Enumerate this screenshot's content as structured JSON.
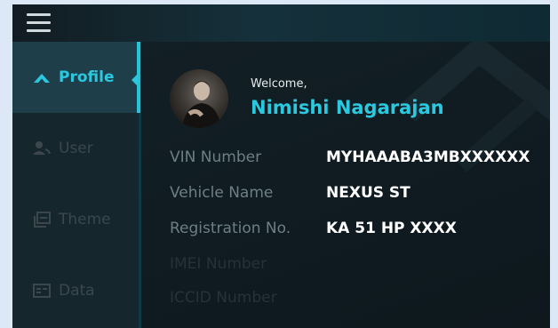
{
  "sidebar": {
    "items": [
      {
        "label": "Profile",
        "icon": "chevron-up-icon",
        "active": true
      },
      {
        "label": "User",
        "icon": "users-icon",
        "active": false
      },
      {
        "label": "Theme",
        "icon": "theme-icon",
        "active": false
      },
      {
        "label": "Data",
        "icon": "data-card-icon",
        "active": false
      }
    ]
  },
  "header": {
    "menu_icon": "hamburger-icon"
  },
  "profile": {
    "welcome": "Welcome,",
    "name": "Nimishi Nagarajan",
    "fields": [
      {
        "label": "VIN Number",
        "value": "MYHAAABA3MBXXXXXX"
      },
      {
        "label": "Vehicle Name",
        "value": "NEXUS ST"
      },
      {
        "label": "Registration No.",
        "value": "KA 51 HP XXXX"
      },
      {
        "label": "IMEI Number",
        "value": ""
      },
      {
        "label": "ICCID Number",
        "value": ""
      }
    ]
  },
  "colors": {
    "accent": "#2bc8e0",
    "background": "#0f1a20",
    "sidebar": "#15262d",
    "sidebar_active": "#1e3f4a"
  }
}
